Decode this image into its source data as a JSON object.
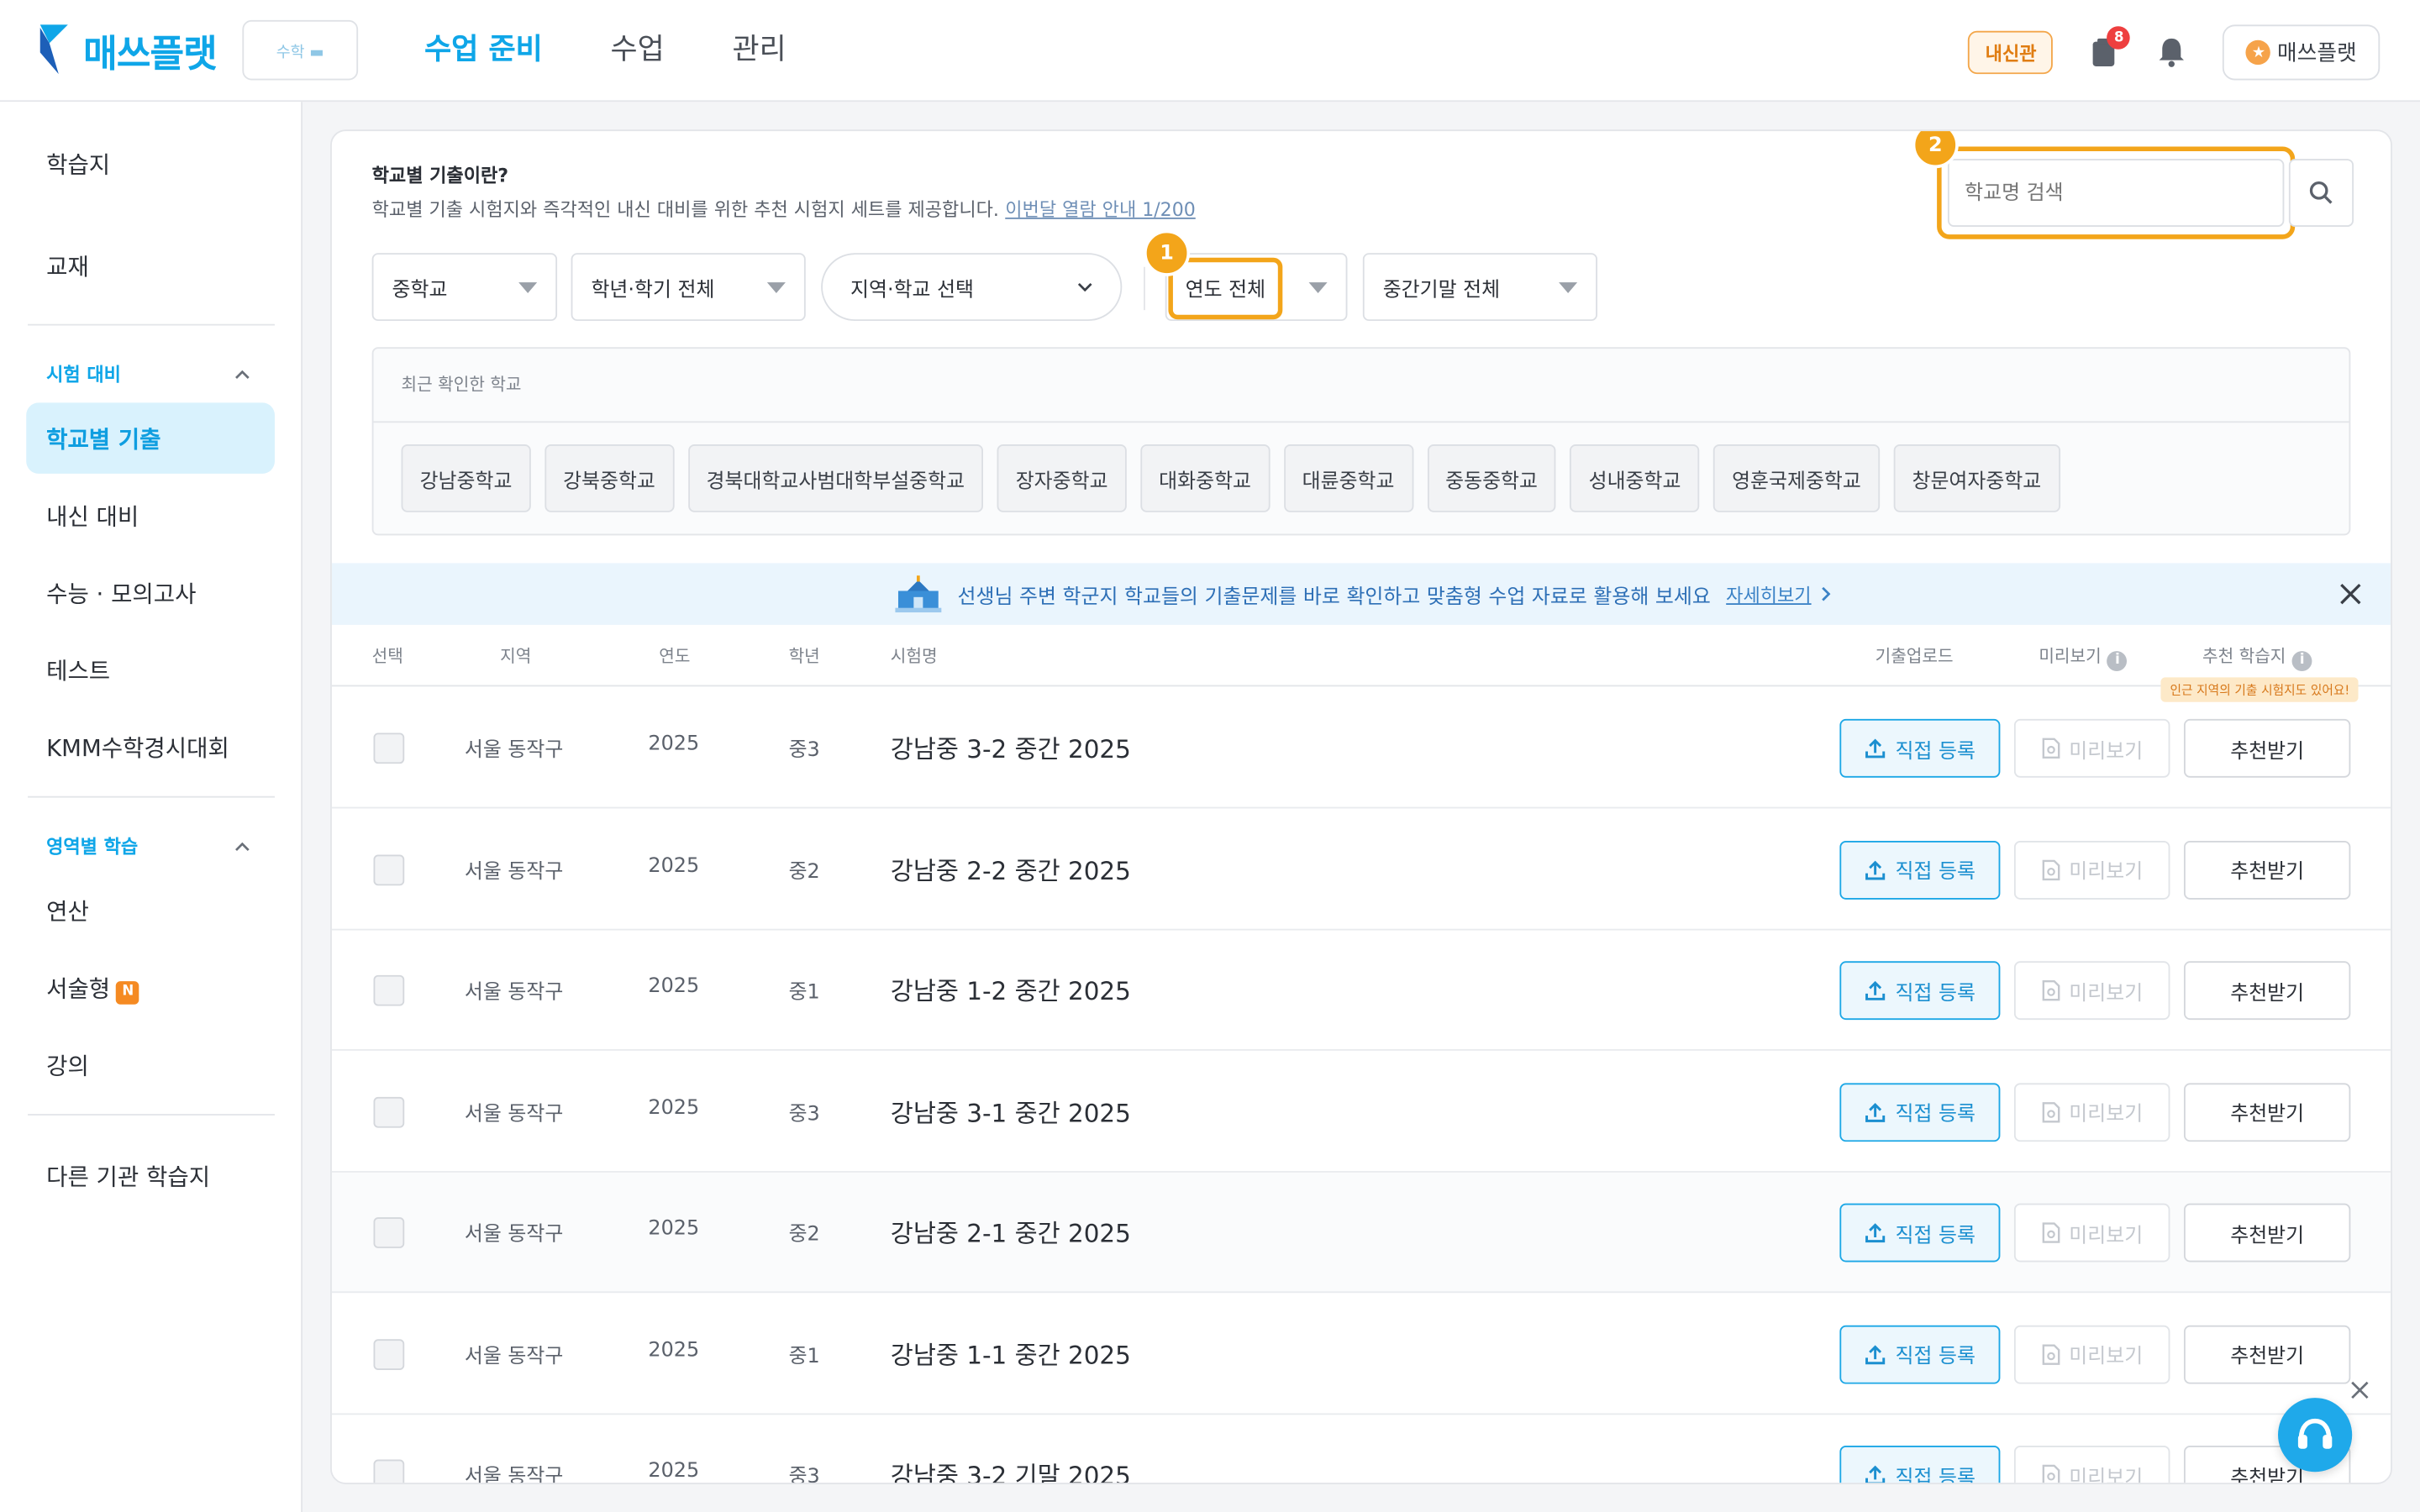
{
  "header": {
    "logo_text": "매쓰플랫",
    "logo_badge": "수학 ▬",
    "nav": [
      "수업 준비",
      "수업",
      "관리"
    ],
    "naesin_label": "내신관",
    "notif_count": "8",
    "profile_label": "매쓰플랫"
  },
  "sidebar": {
    "top_items": [
      "학습지",
      "교재"
    ],
    "section1_title": "시험 대비",
    "section1_items": [
      "학교별 기출",
      "내신 대비",
      "수능 · 모의고사",
      "테스트",
      "KMM수학경시대회"
    ],
    "section2_title": "영역별 학습",
    "section2_items": [
      "연산",
      "서술형",
      "강의"
    ],
    "new_badge": "N",
    "bottom_item": "다른 기관 학습지"
  },
  "intro": {
    "title": "학교별 기출이란?",
    "desc": "학교별 기출 시험지와 즉각적인 내신 대비를 위한 추천 시험지 세트를 제공합니다.",
    "link": "이번달 열람 안내 1/200"
  },
  "search": {
    "placeholder": "학교명 검색",
    "marker": "2"
  },
  "filters": {
    "level": "중학교",
    "grade": "학년·학기 전체",
    "region": "지역·학교 선택",
    "year": "연도 전체",
    "year_marker": "1",
    "term": "중간기말 전체"
  },
  "recent": {
    "label": "최근 확인한 학교",
    "schools": [
      "강남중학교",
      "강북중학교",
      "경북대학교사범대학부설중학교",
      "장자중학교",
      "대화중학교",
      "대륜중학교",
      "중동중학교",
      "성내중학교",
      "영훈국제중학교",
      "창문여자중학교"
    ]
  },
  "banner": {
    "text": "선생님 주변 학군지 학교들의 기출문제를 바로 확인하고 맞춤형 수업 자료로 활용해 보세요",
    "link": "자세히보기"
  },
  "table": {
    "headers": {
      "select": "선택",
      "region": "지역",
      "year": "연도",
      "grade": "학년",
      "name": "시험명",
      "upload": "기출업로드",
      "preview": "미리보기",
      "recommend": "추천 학습지"
    },
    "tooltip": "인근 지역의 기출 시험지도 있어요!",
    "upload_label": "직접 등록",
    "preview_label": "미리보기",
    "recommend_label": "추천받기",
    "rows": [
      {
        "region": "서울 동작구",
        "year": "2025",
        "grade": "중3",
        "name": "강남중 3-2 중간 2025"
      },
      {
        "region": "서울 동작구",
        "year": "2025",
        "grade": "중2",
        "name": "강남중 2-2 중간 2025"
      },
      {
        "region": "서울 동작구",
        "year": "2025",
        "grade": "중1",
        "name": "강남중 1-2 중간 2025"
      },
      {
        "region": "서울 동작구",
        "year": "2025",
        "grade": "중3",
        "name": "강남중 3-1 중간 2025"
      },
      {
        "region": "서울 동작구",
        "year": "2025",
        "grade": "중2",
        "name": "강남중 2-1 중간 2025"
      },
      {
        "region": "서울 동작구",
        "year": "2025",
        "grade": "중1",
        "name": "강남중 1-1 중간 2025"
      },
      {
        "region": "서울 동작구",
        "year": "2025",
        "grade": "중3",
        "name": "강남중 3-2 기말 2025"
      }
    ]
  },
  "colors": {
    "accent": "#0fa6e8",
    "highlight": "#f3a51a",
    "badge_red": "#ee3f3f"
  }
}
